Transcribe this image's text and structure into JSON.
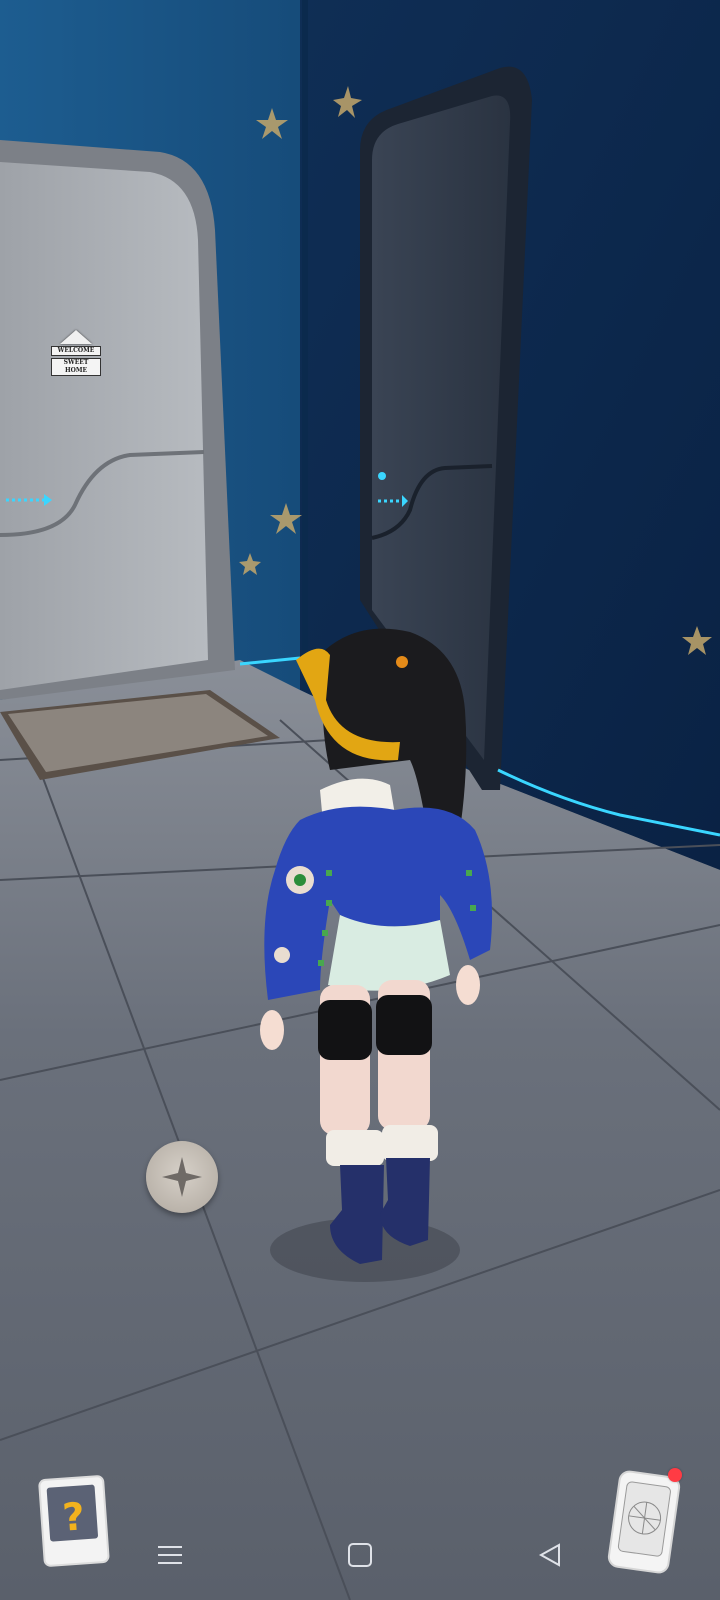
{
  "scene": {
    "door_sign": {
      "line1": "WELCOME",
      "line2": "SWEET",
      "line3": "HOME"
    }
  },
  "controls": {
    "joystick_icon": "four-point-star-icon",
    "help_card_icon": "question-mark-icon",
    "phone_icon": "phone-map-icon",
    "phone_has_notification": true
  },
  "system_nav": {
    "items": [
      "menu-icon",
      "home-square-icon",
      "back-triangle-icon"
    ]
  },
  "colors": {
    "wall": "#123a63",
    "floor": "#646a75",
    "neon": "#3ad6ff",
    "badge": "#ff3b44"
  }
}
